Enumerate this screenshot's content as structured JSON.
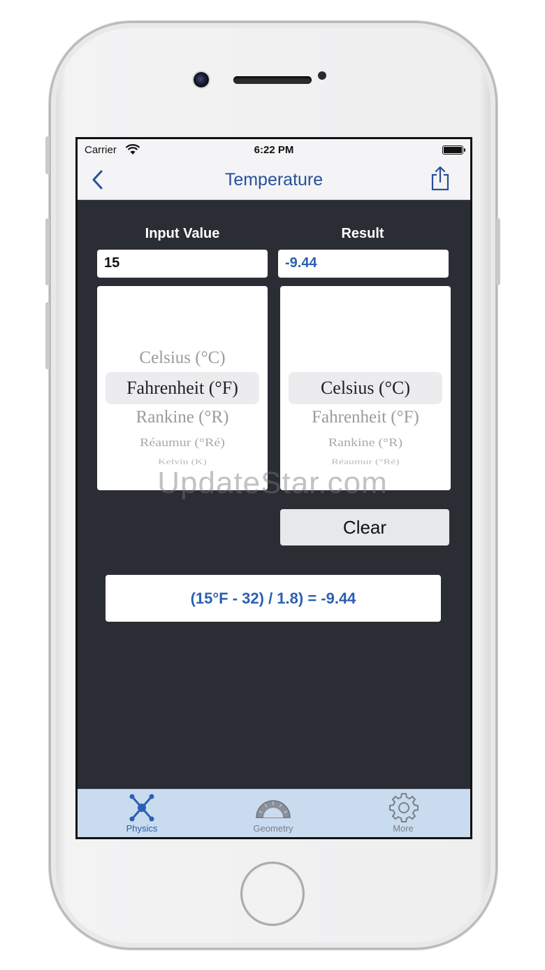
{
  "status_bar": {
    "carrier": "Carrier",
    "time": "6:22 PM"
  },
  "nav": {
    "title": "Temperature"
  },
  "converter": {
    "input_label": "Input Value",
    "result_label": "Result",
    "input_value": "15",
    "result_value": "-9.44",
    "from_units": [
      "Celsius (°C)",
      "Fahrenheit (°F)",
      "Rankine (°R)",
      "Réaumur (°Ré)",
      "Kelvin (K)"
    ],
    "from_selected": "Fahrenheit (°F)",
    "to_units": [
      "Celsius (°C)",
      "Fahrenheit (°F)",
      "Rankine (°R)",
      "Réaumur (°Ré)"
    ],
    "to_selected": "Celsius (°C)",
    "clear_label": "Clear",
    "formula": "(15°F - 32) / 1.8) = -9.44"
  },
  "tabs": [
    {
      "label": "Physics",
      "icon": "molecule-icon",
      "active": true
    },
    {
      "label": "Geometry",
      "icon": "protractor-icon",
      "active": false
    },
    {
      "label": "More",
      "icon": "gear-icon",
      "active": false
    }
  ],
  "watermark": "UpdateStar.com",
  "colors": {
    "accent": "#27509a",
    "result_text": "#2b5fb3",
    "tab_bg": "#c9dbee",
    "screen_bg": "#2a2d33"
  }
}
